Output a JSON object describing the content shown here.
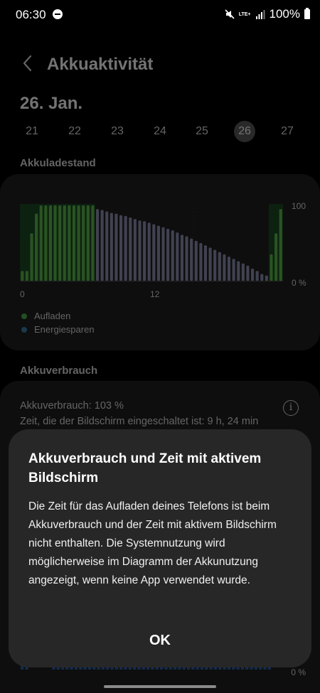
{
  "status_bar": {
    "time": "06:30",
    "network": "LTE+",
    "battery": "100%"
  },
  "header": {
    "title": "Akkuaktivität"
  },
  "date_title": "26. Jan.",
  "days": [
    "21",
    "22",
    "23",
    "24",
    "25",
    "26",
    "27"
  ],
  "selected_day": "26",
  "battery_level_section": {
    "label": "Akkuladestand",
    "y_top_label": "100",
    "y_bottom_label": "0 %",
    "x_labels": [
      "0",
      "12"
    ],
    "legend": [
      {
        "label": "Aufladen",
        "color": "#4caf50"
      },
      {
        "label": "Energiesparen",
        "color": "#3d7fa8"
      }
    ]
  },
  "chart_data": {
    "type": "bar",
    "ylim": [
      0,
      100
    ],
    "x_ticks": [
      "0",
      "12"
    ],
    "legend": [
      "Aufladen",
      "Energiesparen"
    ],
    "values": [
      13,
      13,
      63,
      89,
      100,
      100,
      100,
      100,
      100,
      100,
      100,
      100,
      100,
      100,
      100,
      100,
      95,
      94,
      92,
      90,
      89,
      87,
      86,
      84,
      82,
      80,
      79,
      77,
      75,
      73,
      71,
      69,
      67,
      64,
      61,
      59,
      56,
      53,
      50,
      47,
      44,
      41,
      38,
      35,
      32,
      29,
      26,
      23,
      20,
      16,
      13,
      9,
      7,
      35,
      63,
      95
    ],
    "charging": [
      true,
      true,
      true,
      true,
      true,
      true,
      true,
      true,
      true,
      true,
      true,
      true,
      true,
      true,
      true,
      true,
      false,
      false,
      false,
      false,
      false,
      false,
      false,
      false,
      false,
      false,
      false,
      false,
      false,
      false,
      false,
      false,
      false,
      false,
      false,
      false,
      false,
      false,
      false,
      false,
      false,
      false,
      false,
      false,
      false,
      false,
      false,
      false,
      false,
      false,
      false,
      false,
      false,
      true,
      true,
      true
    ],
    "colors": {
      "charging": "#5dbb4d",
      "discharging": "#8f93b4",
      "charging_bg": "#1d4a27"
    }
  },
  "usage_section": {
    "label": "Akkuverbrauch",
    "usage_line": "Akkuverbrauch: 103 %",
    "screen_time_line": "Zeit, die der Bildschirm eingeschaltet ist: 9 h, 24 min",
    "y_bottom_label": "0 %"
  },
  "dialog": {
    "title": "Akkuverbrauch und Zeit mit aktivem Bildschirm",
    "body": "Die Zeit für das Aufladen deines Telefons ist beim Akkuverbrauch und der Zeit mit aktivem Bildschirm nicht enthalten. Die Systemnutzung wird möglicherweise im Diagramm der Akkunutzung angezeigt, wenn keine App verwendet wurde.",
    "ok_label": "OK"
  }
}
